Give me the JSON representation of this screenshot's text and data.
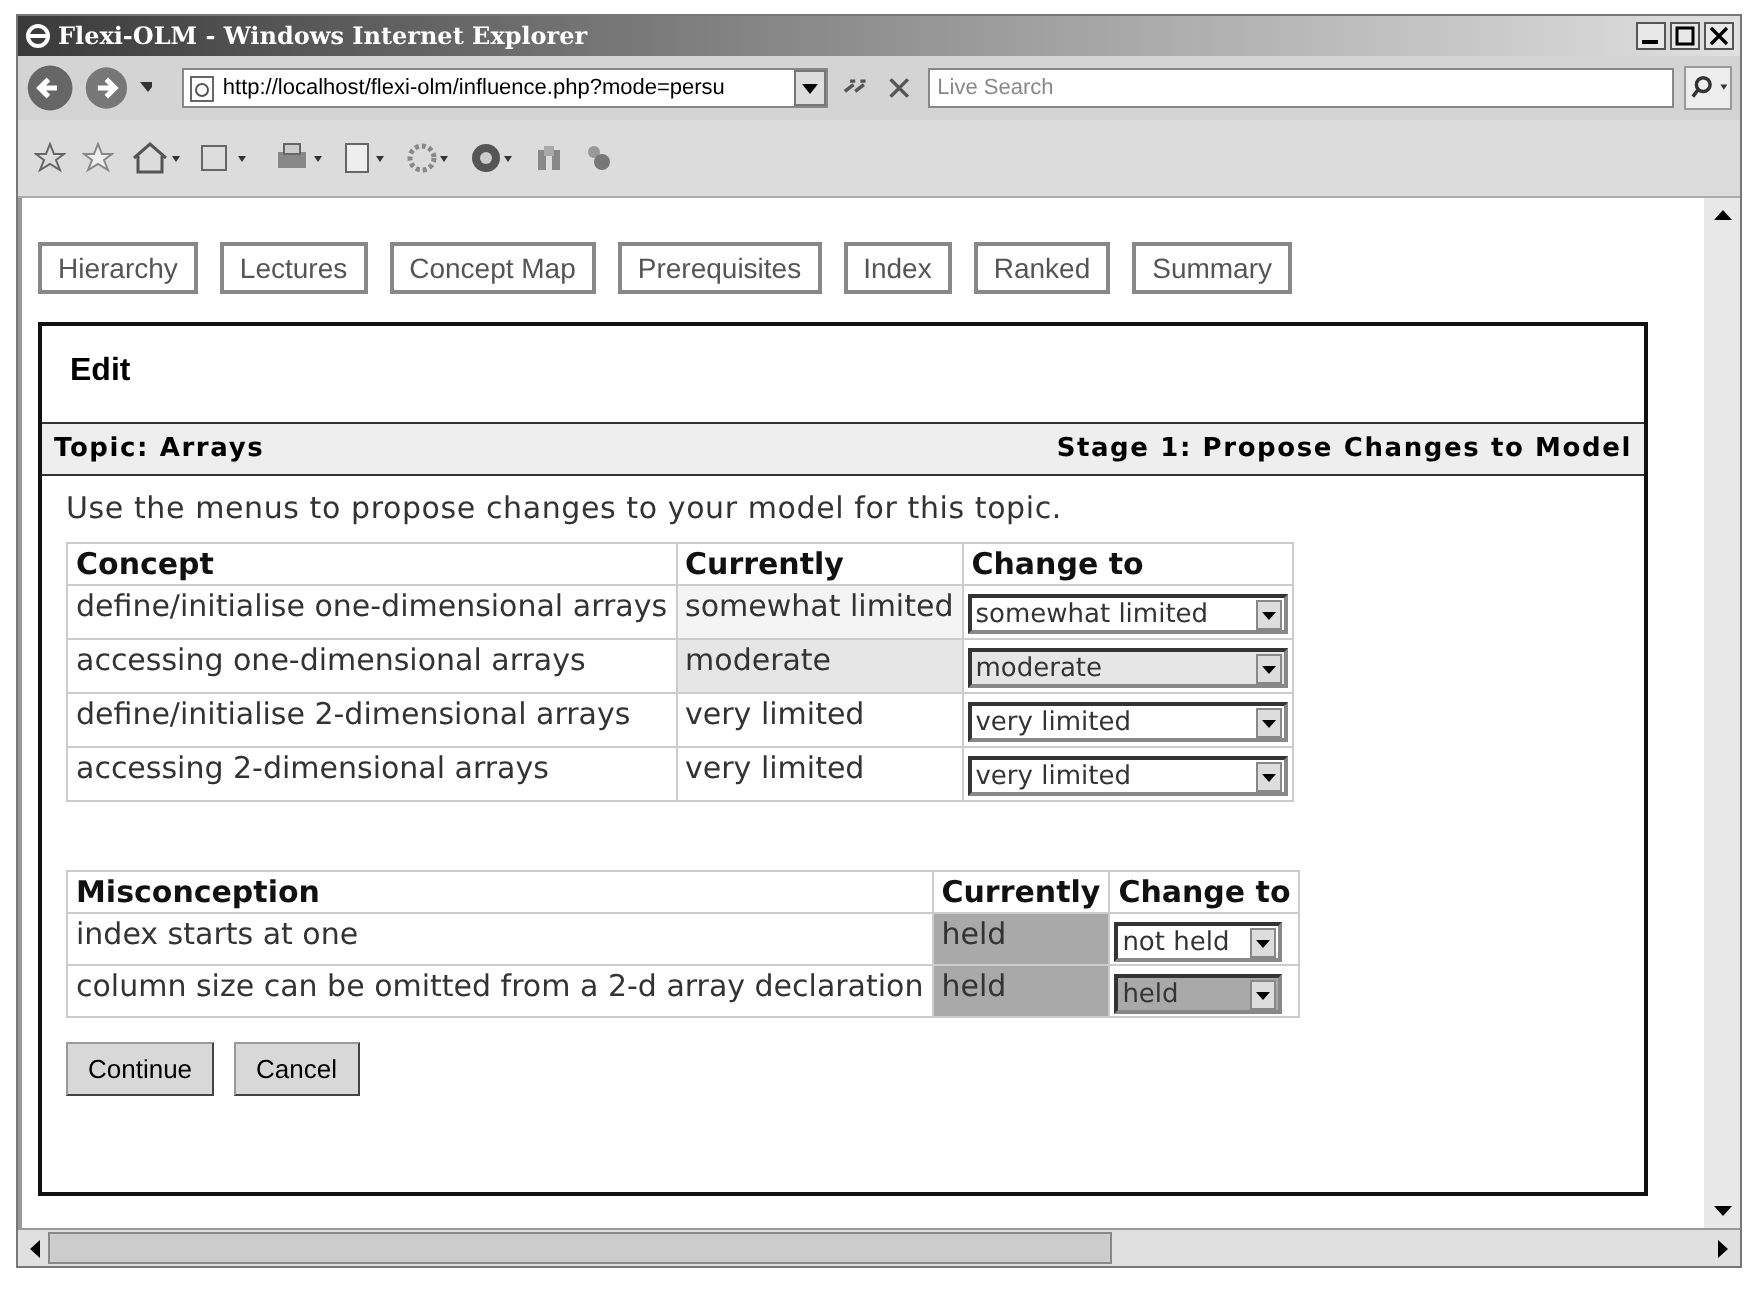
{
  "window": {
    "title": "Flexi-OLM - Windows Internet Explorer"
  },
  "address_bar": {
    "value": "http://localhost/flexi-olm/influence.php?mode=persu"
  },
  "search": {
    "placeholder": "Live Search"
  },
  "nav_tabs": [
    {
      "label": "Hierarchy"
    },
    {
      "label": "Lectures"
    },
    {
      "label": "Concept Map"
    },
    {
      "label": "Prerequisites"
    },
    {
      "label": "Index"
    },
    {
      "label": "Ranked"
    },
    {
      "label": "Summary"
    }
  ],
  "panel": {
    "title": "Edit",
    "topic": "Topic: Arrays",
    "stage": "Stage 1: Propose Changes to Model",
    "instructions": "Use the menus to propose changes to your model for this topic."
  },
  "concept_table": {
    "columns": [
      "Concept",
      "Currently",
      "Change to"
    ],
    "rows": [
      {
        "concept": "define/initialise one-dimensional arrays",
        "currently": {
          "value": "somewhat limited",
          "color": "#f4f4f4"
        },
        "change_to": {
          "value": "somewhat limited",
          "color": "#ffffff"
        }
      },
      {
        "concept": "accessing one-dimensional arrays",
        "currently": {
          "value": "moderate",
          "color": "#e6e6e6"
        },
        "change_to": {
          "value": "moderate",
          "color": "#e6e6e6"
        }
      },
      {
        "concept": "define/initialise 2-dimensional arrays",
        "currently": {
          "value": "very limited",
          "color": "#ffffff"
        },
        "change_to": {
          "value": "very limited",
          "color": "#ffffff"
        }
      },
      {
        "concept": "accessing 2-dimensional arrays",
        "currently": {
          "value": "very limited",
          "color": "#ffffff"
        },
        "change_to": {
          "value": "very limited",
          "color": "#ffffff"
        }
      }
    ]
  },
  "misconception_table": {
    "columns": [
      "Misconception",
      "Currently",
      "Change to"
    ],
    "rows": [
      {
        "misconception": "index starts at one",
        "currently": {
          "value": "held",
          "color": "#a9a9a9"
        },
        "change_to": {
          "value": "not held",
          "color": "#ffffff"
        }
      },
      {
        "misconception": "column size can be omitted from a 2-d array declaration",
        "currently": {
          "value": "held",
          "color": "#a9a9a9"
        },
        "change_to": {
          "value": "held",
          "color": "#a9a9a9"
        }
      }
    ]
  },
  "buttons": [
    "Continue",
    "Cancel"
  ]
}
